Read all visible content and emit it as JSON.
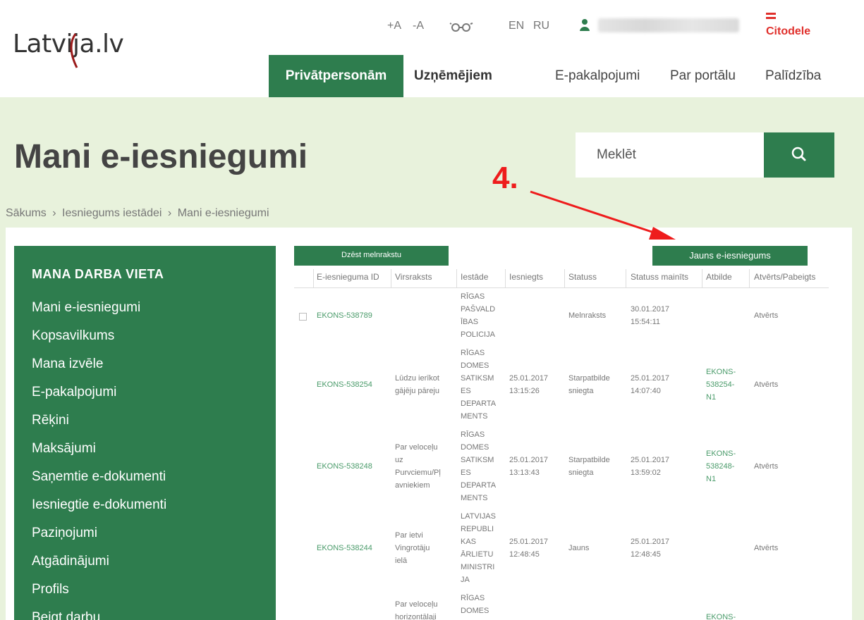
{
  "header": {
    "logo": "Latvija.lv",
    "font_plus": "+A",
    "font_minus": "-A",
    "lang_en": "EN",
    "lang_ru": "RU",
    "bank": "Citodele"
  },
  "nav": {
    "private": "Privātpersonām",
    "business": "Uzņēmējiem",
    "eservices": "E-pakalpojumi",
    "about": "Par portālu",
    "help": "Palīdzība"
  },
  "page": {
    "title": "Mani e-iesniegumi",
    "search_placeholder": "Meklēt"
  },
  "breadcrumb": [
    "Sākums",
    "›",
    "Iesniegums iestādei",
    "›",
    "Mani e-iesniegumi"
  ],
  "sidebar": {
    "title": "MANA DARBA VIETA",
    "items": [
      "Mani e-iesniegumi",
      "Kopsavilkums",
      "Mana izvēle",
      "E-pakalpojumi",
      "Rēķini",
      "Maksājumi",
      "Saņemtie e-dokumenti",
      "Iesniegtie e-dokumenti",
      "Paziņojumi",
      "Atgādinājumi",
      "Profils",
      "Beigt darbu"
    ]
  },
  "actions": {
    "delete_draft": "Dzēst melnrakstu",
    "new_application": "Jauns e-iesniegums"
  },
  "annotation": "4.",
  "table": {
    "columns": [
      "E-iesnieguma ID",
      "Virsraksts",
      "Iestāde",
      "Iesniegts",
      "Statuss",
      "Statuss mainīts",
      "Atbilde",
      "Atvērts/Pabeigts"
    ],
    "rows": [
      {
        "id": "EKONS-538789",
        "title": [],
        "institution": [
          "RĪGAS",
          "PAŠVALD",
          "ĪBAS",
          "POLICIJA"
        ],
        "submitted": [],
        "status": [
          "Melnraksts"
        ],
        "changed": [
          "30.01.2017",
          "15:54:11"
        ],
        "answer": [],
        "open": "Atvērts"
      },
      {
        "id": "EKONS-538254",
        "title": [
          "Lūdzu ierīkot",
          "gājēju pāreju"
        ],
        "institution": [
          "RĪGAS",
          "DOMES",
          "SATIKSM",
          "ES",
          "DEPARTA",
          "MENTS"
        ],
        "submitted": [
          "25.01.2017",
          "13:15:26"
        ],
        "status": [
          "Starpatbilde",
          "sniegta"
        ],
        "changed": [
          "25.01.2017",
          "14:07:40"
        ],
        "answer": [
          "EKONS-",
          "538254-",
          "N1"
        ],
        "open": "Atvērts"
      },
      {
        "id": "EKONS-538248",
        "title": [
          "Par veloceļu",
          "uz",
          "Purvciemu/Pļ",
          "avniekiem"
        ],
        "institution": [
          "RĪGAS",
          "DOMES",
          "SATIKSM",
          "ES",
          "DEPARTA",
          "MENTS"
        ],
        "submitted": [
          "25.01.2017",
          "13:13:43"
        ],
        "status": [
          "Starpatbilde",
          "sniegta"
        ],
        "changed": [
          "25.01.2017",
          "13:59:02"
        ],
        "answer": [
          "EKONS-",
          "538248-",
          "N1"
        ],
        "open": "Atvērts"
      },
      {
        "id": "EKONS-538244",
        "title": [
          "Par ietvi",
          "Vingrotāju",
          "ielā"
        ],
        "institution": [
          "LATVIJAS",
          "REPUBLI",
          "KAS",
          "ĀRLIETU",
          "MINISTRI",
          "JA"
        ],
        "submitted": [
          "25.01.2017",
          "12:48:45"
        ],
        "status": [
          "Jauns"
        ],
        "changed": [
          "25.01.2017",
          "12:48:45"
        ],
        "answer": [],
        "open": "Atvērts"
      },
      {
        "id": "",
        "title": [
          "Par veloceļu",
          "horizontālaji"
        ],
        "institution": [
          "RĪGAS",
          "DOMES"
        ],
        "submitted": [],
        "status": [],
        "changed": [],
        "answer": [
          "EKONS-"
        ],
        "open": ""
      }
    ]
  },
  "colors": {
    "green": "#2e7d4e",
    "light_green": "#e8f2dc",
    "link_green": "#4a9b6a",
    "annotation_red": "#ee1c1c",
    "bank_red": "#e0302c"
  }
}
